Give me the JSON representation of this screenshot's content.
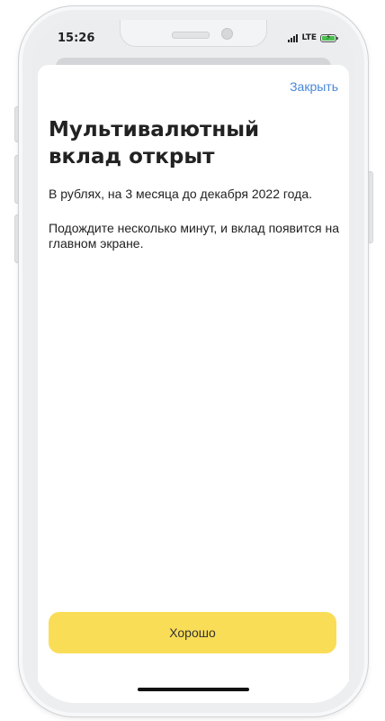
{
  "status_bar": {
    "time": "15:26",
    "network": "LTE"
  },
  "modal": {
    "close_label": "Закрыть",
    "title": "Мультивалютный вклад открыт",
    "details": "В рублях, на 3 месяца до декабря 2022 года.",
    "note": "Подождите несколько минут, и вклад появится на главном экране.",
    "ok_label": "Хорошо"
  },
  "icons": {
    "signal": "signal-icon",
    "battery": "battery-charging-icon"
  },
  "colors": {
    "accent_link": "#4a88d8",
    "primary_button": "#f9dd57",
    "battery_fill": "#49c14f"
  }
}
